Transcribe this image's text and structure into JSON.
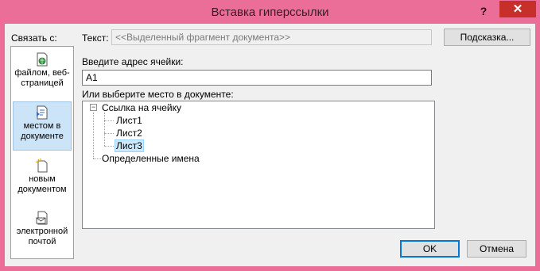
{
  "dialog": {
    "title": "Вставка гиперссылки",
    "help_glyph": "?",
    "close_glyph": "✕"
  },
  "link_with": {
    "label": "Связать с:",
    "items": [
      {
        "label": "файлом, веб-страницей",
        "icon": "web-page-icon"
      },
      {
        "label": "местом в документе",
        "icon": "document-place-icon"
      },
      {
        "label": "новым документом",
        "icon": "new-document-icon"
      },
      {
        "label": "электронной почтой",
        "icon": "email-icon"
      }
    ],
    "selected_index": 1
  },
  "text_to_display": {
    "label": "Текст:",
    "value": "<<Выделенный фрагмент документа>>"
  },
  "tooltip_button": "Подсказка...",
  "cell_reference": {
    "label": "Введите адрес ячейки:",
    "value": "A1"
  },
  "place": {
    "label": "Или выберите место в документе:",
    "tree": {
      "cell_ref_group": "Ссылка на ячейку",
      "sheets": [
        "Лист1",
        "Лист2",
        "Лист3"
      ],
      "selected_sheet": "Лист3",
      "defined_names": "Определенные имена",
      "collapse_glyph": "−"
    }
  },
  "buttons": {
    "ok": "OK",
    "cancel": "Отмена"
  },
  "colors": {
    "frame": "#ea6e97",
    "close": "#c7302a",
    "selection": "#cce8ff"
  }
}
